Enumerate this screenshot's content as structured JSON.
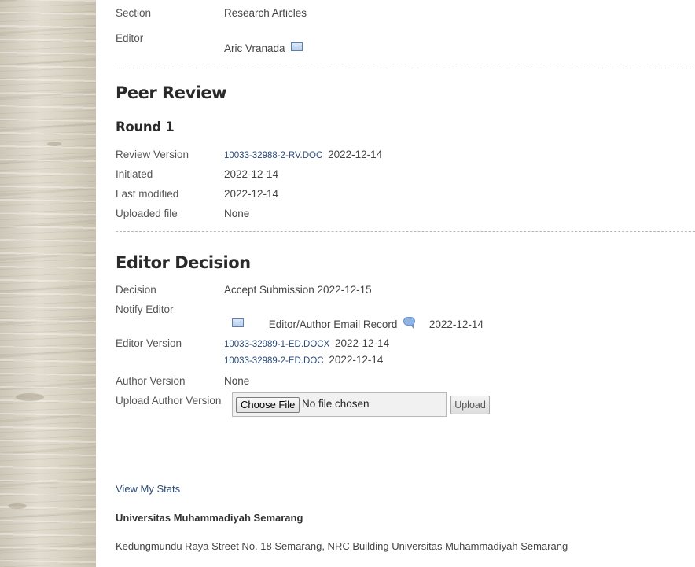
{
  "submission": {
    "section_label": "Section",
    "section_value": "Research Articles",
    "editor_label": "Editor",
    "editor_value": "Aric Vranada",
    "editor_icon": "envelope-icon"
  },
  "peer_review": {
    "title": "Peer Review",
    "round_title": "Round 1",
    "review_version_label": "Review Version",
    "review_version_file": "10033-32988-2-RV.DOC",
    "review_version_date": "2022-12-14",
    "initiated_label": "Initiated",
    "initiated_value": "2022-12-14",
    "last_modified_label": "Last modified",
    "last_modified_value": "2022-12-14",
    "uploaded_file_label": "Uploaded file",
    "uploaded_file_value": "None"
  },
  "editor_decision": {
    "title": "Editor Decision",
    "decision_label": "Decision",
    "decision_value": "Accept Submission 2022-12-15",
    "notify_label": "Notify Editor",
    "notify_icon": "envelope-icon",
    "email_record_label": "Editor/Author Email Record",
    "email_record_icon": "comment-icon",
    "email_record_date": "2022-12-14",
    "editor_version_label": "Editor Version",
    "editor_versions": [
      {
        "file": "10033-32989-1-ED.DOCX",
        "date": "2022-12-14"
      },
      {
        "file": "10033-32989-2-ED.DOC",
        "date": "2022-12-14"
      }
    ],
    "author_version_label": "Author Version",
    "author_version_value": "None",
    "upload_author_label": "Upload Author Version",
    "choose_file_label": "Choose File",
    "no_file_text": "No file chosen",
    "upload_button_label": "Upload"
  },
  "footer": {
    "stats_link": "View My Stats",
    "org_name": "Universitas Muhammadiyah Semarang",
    "address": "Kedungmundu Raya Street No. 18 Semarang, NRC Building Universitas Muhammadiyah Semarang"
  }
}
